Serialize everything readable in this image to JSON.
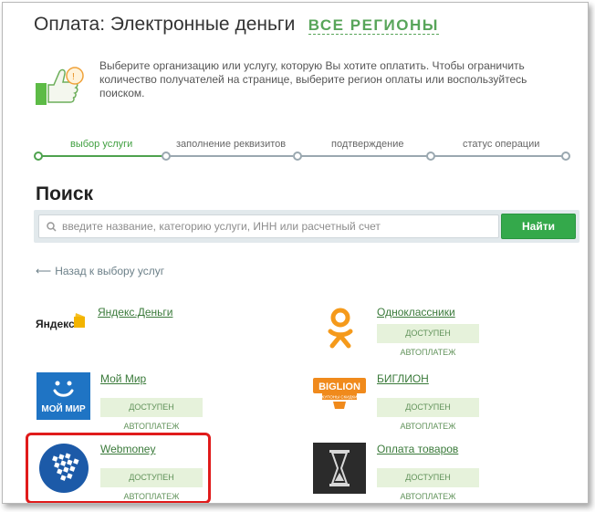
{
  "header": {
    "title": "Оплата: Электронные деньги",
    "region_link": "ВСЕ РЕГИОНЫ"
  },
  "hint": {
    "text": "Выберите организацию или услугу, которую Вы хотите оплатить. Чтобы ограничить количество получателей на странице, выберите регион оплаты или воспользуйтесь поиском."
  },
  "steps": [
    {
      "label": "выбор услуги",
      "active": true
    },
    {
      "label": "заполнение реквизитов",
      "active": false
    },
    {
      "label": "подтверждение",
      "active": false
    },
    {
      "label": "статус операции",
      "active": false
    }
  ],
  "search": {
    "heading": "Поиск",
    "placeholder": "введите название, категорию услуги, ИНН или расчетный счет",
    "button": "Найти"
  },
  "back_link": "Назад к выбору услуг",
  "providers": [
    {
      "name": "Яндекс.Деньги",
      "badge": "",
      "logo_text": "Яндекс"
    },
    {
      "name": "Одноклассники",
      "badge": "ДОСТУПЕН АВТОПЛАТЕЖ",
      "logo_text": ""
    },
    {
      "name": "Мой Мир",
      "badge": "ДОСТУПЕН АВТОПЛАТЕЖ",
      "logo_text": "МОЙ МИР"
    },
    {
      "name": "БИГЛИОН",
      "badge": "ДОСТУПЕН АВТОПЛАТЕЖ",
      "logo_text": "BIGLION",
      "logo_subtext": "КУПОНЫ СКИДКИ"
    },
    {
      "name": "Webmoney",
      "badge": "ДОСТУПЕН АВТОПЛАТЕЖ",
      "logo_text": ""
    },
    {
      "name": "Оплата товаров",
      "badge": "ДОСТУПЕН АВТОПЛАТЕЖ",
      "logo_text": ""
    }
  ],
  "colors": {
    "accent_green": "#34a94b",
    "link_green": "#58a55a",
    "highlight_red": "#e01b1b"
  },
  "icons": [
    "thumbs-up-icon",
    "search-icon",
    "arrow-left-icon",
    "hourglass-icon"
  ]
}
